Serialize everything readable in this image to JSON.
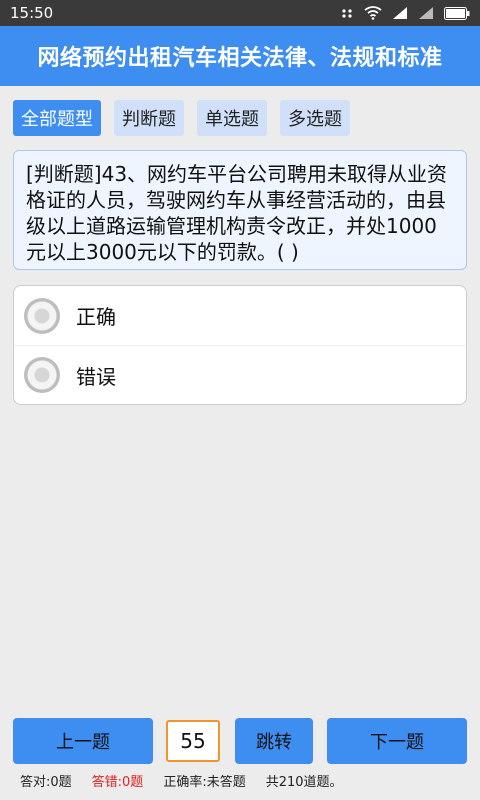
{
  "status_bar": {
    "time": "15:50"
  },
  "header": {
    "title": "网络预约出租汽车相关法律、法规和标准"
  },
  "filter_tabs": [
    {
      "label": "全部题型",
      "active": true
    },
    {
      "label": "判断题",
      "active": false
    },
    {
      "label": "单选题",
      "active": false
    },
    {
      "label": "多选题",
      "active": false
    }
  ],
  "question": {
    "text": "[判断题]43、网约车平台公司聘用未取得从业资格证的人员，驾驶网约车从事经营活动的，由县级以上道路运输管理机构责令改正，并处1000元以上3000元以下的罚款。( )"
  },
  "options": [
    {
      "label": "正确"
    },
    {
      "label": "错误"
    }
  ],
  "navigation": {
    "prev_label": "上一题",
    "page_value": "55",
    "jump_label": "跳转",
    "next_label": "下一题"
  },
  "stats": {
    "correct": "答对:0题",
    "wrong": "答错:0题",
    "accuracy": "正确率:未答题",
    "total": "共210道题。"
  },
  "colors": {
    "primary": "#3d8ef0",
    "tab_inactive": "#cfe0f8",
    "wrong_text": "#e02020",
    "input_border": "#f0952e"
  }
}
